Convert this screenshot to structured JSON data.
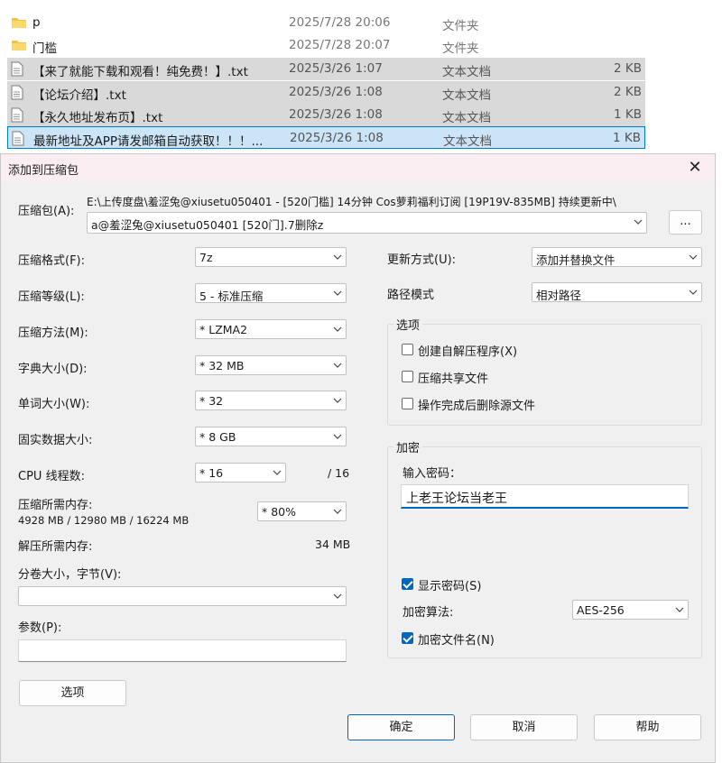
{
  "file_list": [
    {
      "name": "p",
      "date": "2025/7/28 20:06",
      "type": "文件夹",
      "size": "",
      "kind": "folder"
    },
    {
      "name": "门槛",
      "date": "2025/7/28 20:07",
      "type": "文件夹",
      "size": "",
      "kind": "folder"
    },
    {
      "name": "【来了就能下载和观看！纯免费！】.txt",
      "date": "2025/3/26 1:07",
      "type": "文本文档",
      "size": "2 KB",
      "kind": "file"
    },
    {
      "name": "【论坛介绍】.txt",
      "date": "2025/3/26 1:08",
      "type": "文本文档",
      "size": "2 KB",
      "kind": "file"
    },
    {
      "name": "【永久地址发布页】.txt",
      "date": "2025/3/26 1:08",
      "type": "文本文档",
      "size": "1 KB",
      "kind": "file"
    },
    {
      "name": "最新地址及APP请发邮箱自动获取！！！...",
      "date": "2025/3/26 1:08",
      "type": "文本文档",
      "size": "1 KB",
      "kind": "file"
    }
  ],
  "dialog": {
    "title": "添加到压缩包",
    "close_glyph": "✕",
    "archive_label": "压缩包(A):",
    "archive_path_line1": "E:\\上传度盘\\羞涩兔@xiusetu050401 - [520门槛] 14分钟 Cos萝莉福利订阅 [19P19V-835MB] 持续更新中\\",
    "archive_path_line2": "a@羞涩兔@xiusetu050401 [520门].7删除z",
    "browse_label": "...",
    "format_label": "压缩格式(F):",
    "format_value": "7z",
    "level_label": "压缩等级(L):",
    "level_value": "5 - 标准压缩",
    "method_label": "压缩方法(M):",
    "method_value": "* LZMA2",
    "dict_label": "字典大小(D):",
    "dict_value": "* 32 MB",
    "word_label": "单词大小(W):",
    "word_value": "* 32",
    "solid_label": "固实数据大小:",
    "solid_value": "* 8 GB",
    "threads_label": "CPU 线程数:",
    "threads_value": "* 16",
    "threads_max": "/ 16",
    "mem_label": "压缩所需内存:",
    "mem_detail": "4928 MB / 12980 MB / 16224 MB",
    "mem_value": "* 80%",
    "decomp_label": "解压所需内存:",
    "decomp_value": "34 MB",
    "split_label": "分卷大小，字节(V):",
    "split_value": "",
    "params_label": "参数(P):",
    "params_value": "",
    "options_button": "选项",
    "update_label": "更新方式(U):",
    "update_value": "添加并替换文件",
    "path_label": "路径模式",
    "path_value": "相对路径",
    "options_group": "选项",
    "opt_sfx": "创建自解压程序(X)",
    "opt_shared": "压缩共享文件",
    "opt_delete": "操作完成后删除源文件",
    "encrypt_group": "加密",
    "password_label": "输入密码：",
    "password_value": "上老王论坛当老王",
    "show_password": "显示密码(S)",
    "enc_method_label": "加密算法:",
    "enc_method_value": "AES-256",
    "encrypt_names": "加密文件名(N)",
    "ok": "确定",
    "cancel": "取消",
    "help": "帮助"
  }
}
